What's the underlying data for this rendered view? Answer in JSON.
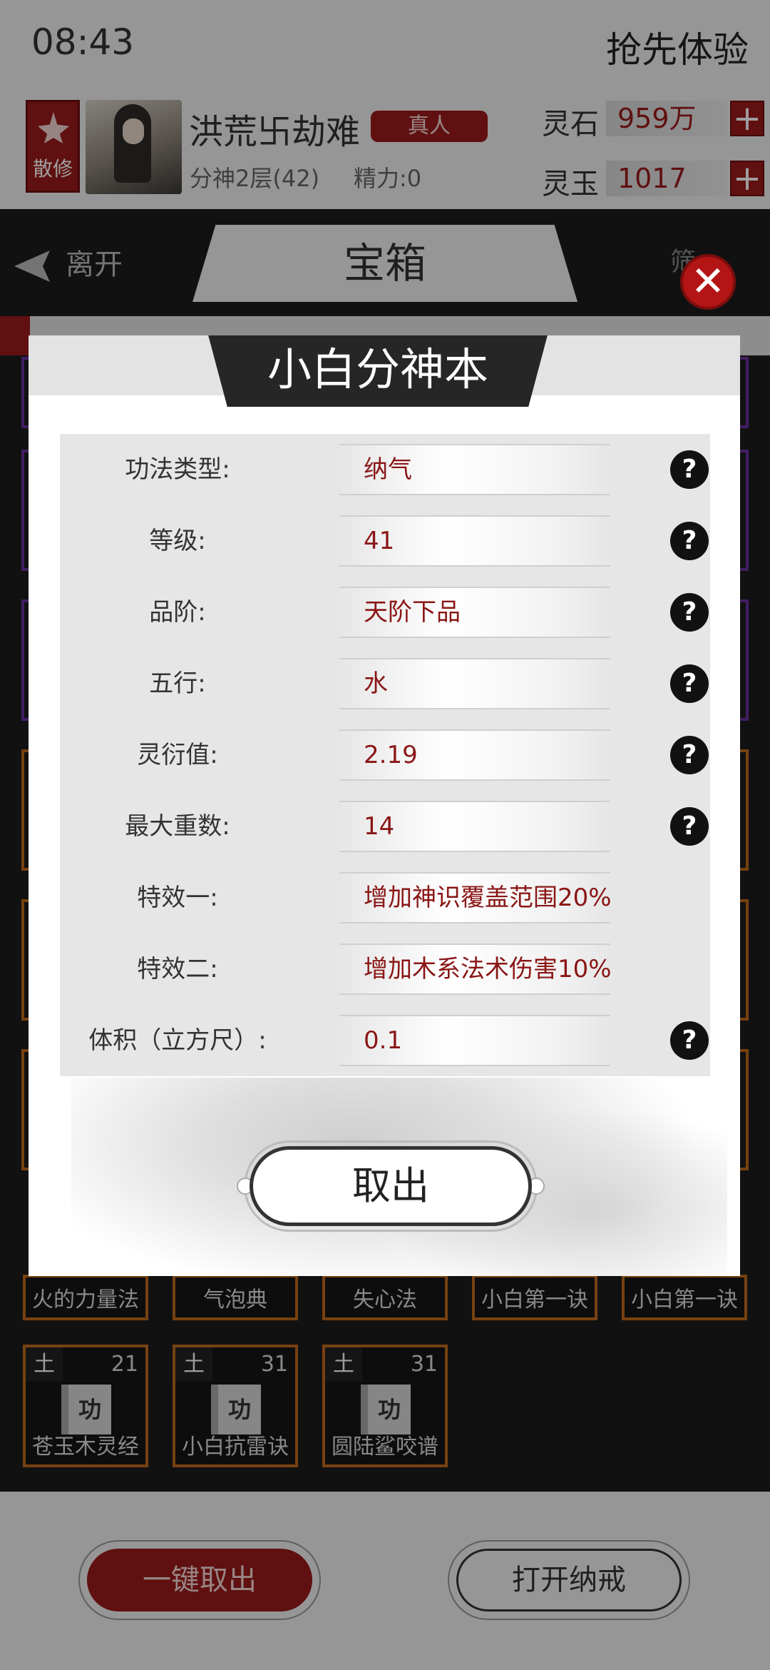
{
  "status": {
    "time": "08:43",
    "promo": "抢先体验"
  },
  "player": {
    "sect": "散修",
    "name": "洪荒卐劫难",
    "rank": "真人",
    "level": "分神2层(42)",
    "energy": "精力:0"
  },
  "resources": [
    {
      "label": "灵石",
      "value": "959万",
      "plus": "+"
    },
    {
      "label": "灵玉",
      "value": "1017",
      "plus": "+"
    }
  ],
  "nav": {
    "leave": "离开",
    "title": "宝箱",
    "filter": "筛"
  },
  "grid": {
    "row_names": [
      "火的力量法",
      "气泡典",
      "失心法",
      "小白第一诀",
      "小白第一诀"
    ],
    "items": [
      {
        "element": "土",
        "level": "21",
        "icon": "功",
        "name": "苍玉木灵经"
      },
      {
        "element": "土",
        "level": "31",
        "icon": "功",
        "name": "小白抗雷诀"
      },
      {
        "element": "土",
        "level": "31",
        "icon": "功",
        "name": "圆陆鲨咬谱"
      }
    ]
  },
  "bottom": {
    "take_all": "一键取出",
    "open_ring": "打开纳戒"
  },
  "modal": {
    "title": "小白分神本",
    "rows": [
      {
        "key": "功法类型:",
        "value": "纳气",
        "help": "?"
      },
      {
        "key": "等级:",
        "value": "41",
        "help": "?"
      },
      {
        "key": "品阶:",
        "value": "天阶下品",
        "help": "?"
      },
      {
        "key": "五行:",
        "value": "水",
        "help": "?"
      },
      {
        "key": "灵衍值:",
        "value": "2.19",
        "help": "?"
      },
      {
        "key": "最大重数:",
        "value": "14",
        "help": "?"
      },
      {
        "key": "特效一:",
        "value": "增加神识覆盖范围20%"
      },
      {
        "key": "特效二:",
        "value": "增加木系法术伤害10%"
      },
      {
        "key": "体积（立方尺）:",
        "value": "0.1",
        "help": "?"
      }
    ],
    "take_out": "取出",
    "close": "✕"
  },
  "colors": {
    "accent": "#9b1b1b",
    "slot_border": "#c0691a",
    "value_text": "#8a1616"
  }
}
